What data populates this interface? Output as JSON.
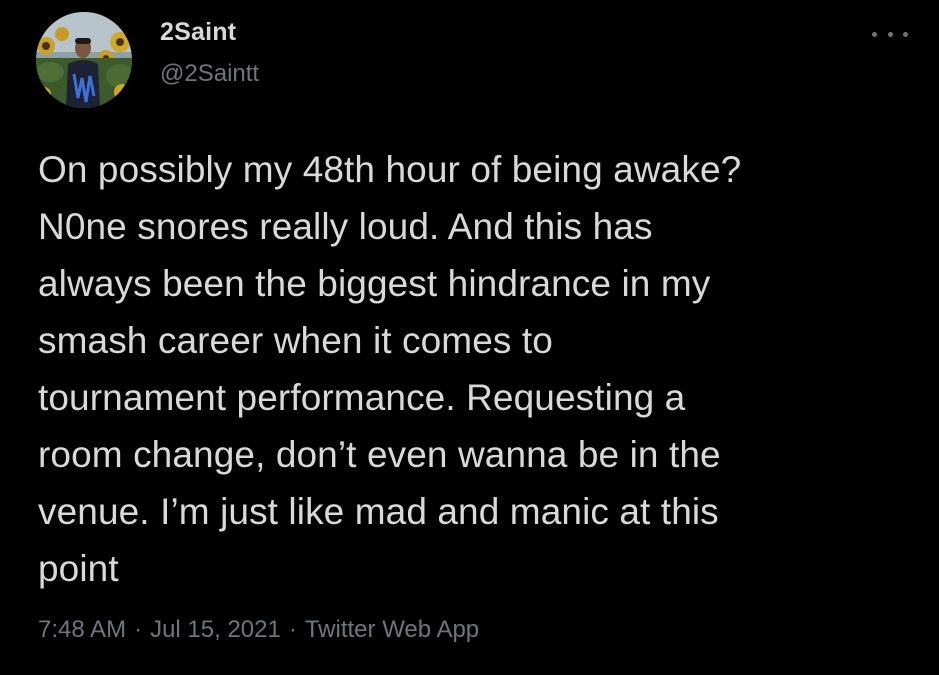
{
  "tweet": {
    "display_name": "2Saint",
    "handle": "@2Saintt",
    "text": "On possibly my 48th hour of being awake?\nN0ne snores really loud. And this has\nalways been the biggest hindrance in my\nsmash career when it comes to\ntournament performance. Requesting a\nroom change, don’t even wanna be in the\nvenue. I’m just like mad and manic at this\npoint",
    "time": "7:48 AM",
    "date": "Jul 15, 2021",
    "source": "Twitter Web App",
    "separator": "·"
  },
  "icons": {
    "more": "more-horizontal-icon",
    "avatar": "profile-photo"
  },
  "colors": {
    "background": "#000000",
    "primary_text": "#d9d9d9",
    "secondary_text": "#6e767d"
  }
}
